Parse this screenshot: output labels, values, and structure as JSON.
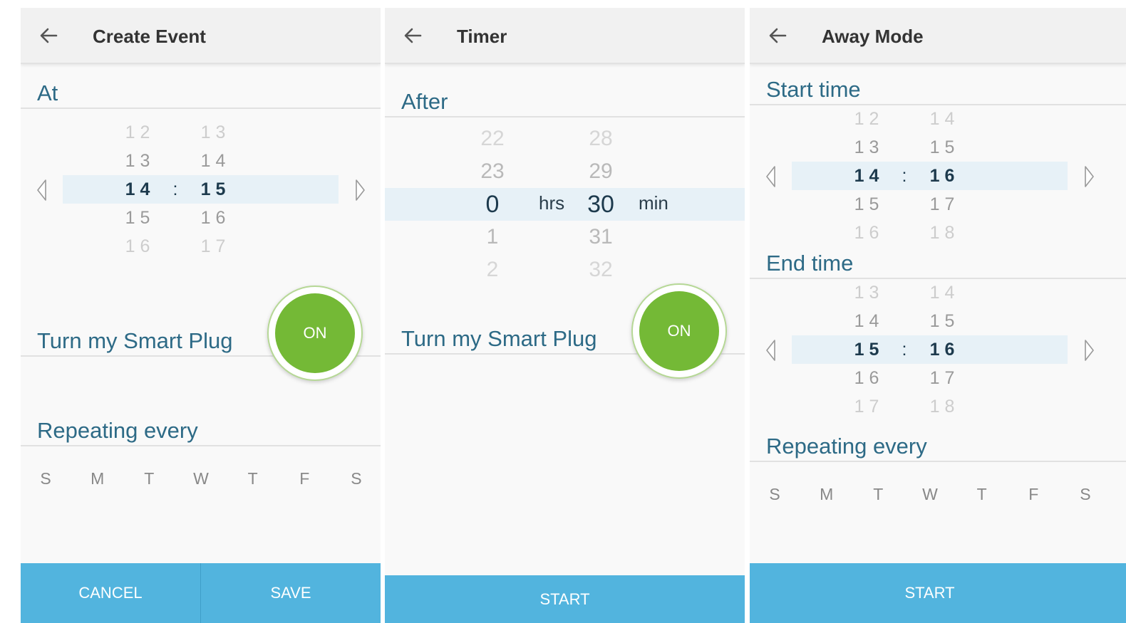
{
  "create_event": {
    "title": "Create Event",
    "at_label": "At",
    "hours": [
      "12",
      "13",
      "14",
      "15",
      "16"
    ],
    "minutes": [
      "13",
      "14",
      "15",
      "16",
      "17"
    ],
    "separator": ":",
    "action_label": "Turn my Smart Plug",
    "toggle_label": "ON",
    "repeat_label": "Repeating every",
    "days": [
      "S",
      "M",
      "T",
      "W",
      "T",
      "F",
      "S"
    ],
    "cancel_label": "CANCEL",
    "save_label": "SAVE"
  },
  "timer": {
    "title": "Timer",
    "after_label": "After",
    "hours": [
      "22",
      "23",
      "0",
      "1",
      "2"
    ],
    "minutes": [
      "28",
      "29",
      "30",
      "31",
      "32"
    ],
    "hours_unit": "hrs",
    "minutes_unit": "min",
    "action_label": "Turn my Smart Plug",
    "toggle_label": "ON",
    "start_label": "START"
  },
  "away_mode": {
    "title": "Away Mode",
    "start_label": "Start time",
    "start_hours": [
      "12",
      "13",
      "14",
      "15",
      "16"
    ],
    "start_minutes": [
      "14",
      "15",
      "16",
      "17",
      "18"
    ],
    "end_label": "End time",
    "end_hours": [
      "13",
      "14",
      "15",
      "16",
      "17"
    ],
    "end_minutes": [
      "14",
      "15",
      "16",
      "17",
      "18"
    ],
    "separator": ":",
    "repeat_label": "Repeating every",
    "days": [
      "S",
      "M",
      "T",
      "W",
      "T",
      "F",
      "S"
    ],
    "start_button_label": "START"
  },
  "colors": {
    "accent_bar": "#52b4de",
    "toggle_on": "#74b936",
    "section_text": "#2d6a86",
    "selected_band": "#e7f1f7"
  }
}
